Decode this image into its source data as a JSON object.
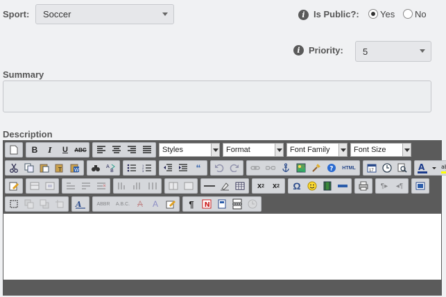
{
  "sport": {
    "label": "Sport:",
    "value": "Soccer"
  },
  "is_public": {
    "label": "Is Public?:",
    "options": [
      "Yes",
      "No"
    ],
    "selected": "Yes"
  },
  "priority": {
    "label": "Priority:",
    "value": "5"
  },
  "summary": {
    "label": "Summary",
    "value": ""
  },
  "description": {
    "label": "Description",
    "dropdowns": [
      "Styles",
      "Format",
      "Font Family",
      "Font Size"
    ]
  },
  "colors": {
    "accent_blue": "#1a5fb4",
    "toolbar_bg": "#5b5b5b"
  }
}
